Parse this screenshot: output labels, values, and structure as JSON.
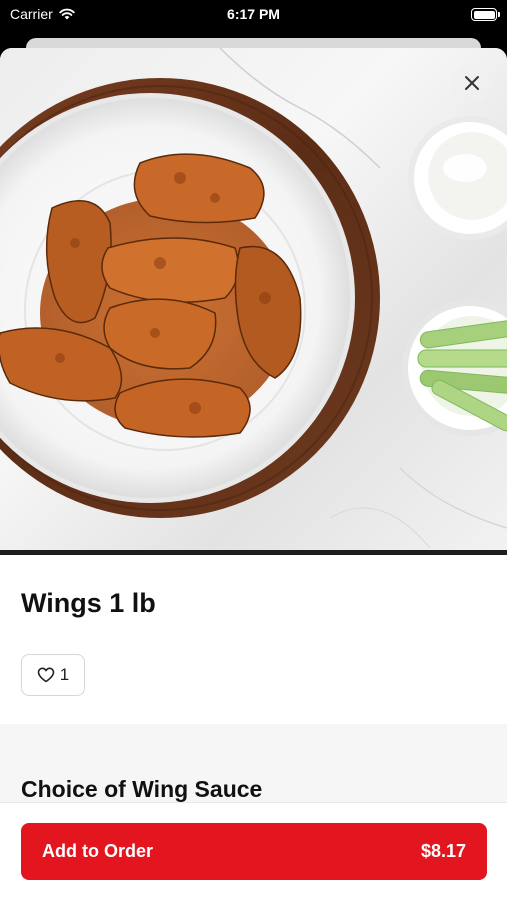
{
  "status_bar": {
    "carrier": "Carrier",
    "time": "6:17 PM"
  },
  "hero": {
    "image": "buffalo-wings-photo",
    "close_icon": "close-icon"
  },
  "item": {
    "title": "Wings 1 lb",
    "likes": "1"
  },
  "options": {
    "section_title": "Choice of Wing Sauce"
  },
  "footer": {
    "add_label": "Add to Order",
    "price": "$8.17"
  },
  "colors": {
    "accent": "#e3151f",
    "text": "#111111",
    "band": "#f6f6f6"
  }
}
